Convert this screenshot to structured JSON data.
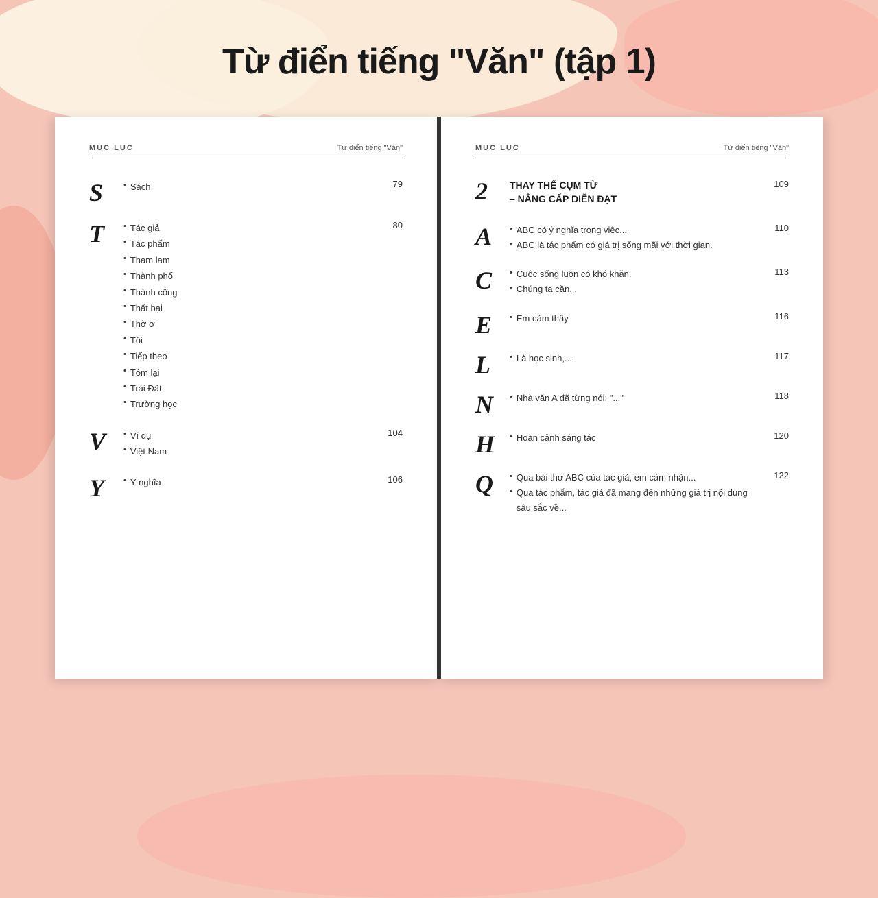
{
  "page": {
    "title": "Từ điển tiếng \"Văn\" (tập 1)",
    "background_color": "#f5c5b8"
  },
  "left_page": {
    "header": {
      "muc_luc": "MỤC LỤC",
      "title": "Từ điển tiếng \"Văn\""
    },
    "sections": [
      {
        "letter": "S",
        "items": [
          "Sách"
        ],
        "page": "79"
      },
      {
        "letter": "T",
        "items": [
          "Tác giả",
          "Tác phẩm",
          "Tham lam",
          "Thành phố",
          "Thành công",
          "Thất bại",
          "Thờ ơ",
          "Tôi",
          "Tiếp theo",
          "Tóm lại",
          "Trái Đất",
          "Trường học"
        ],
        "page": "80"
      },
      {
        "letter": "V",
        "items": [
          "Ví dụ",
          "Việt Nam"
        ],
        "page": "104"
      },
      {
        "letter": "Y",
        "items": [
          "Ý nghĩa"
        ],
        "page": "106"
      }
    ]
  },
  "right_page": {
    "header": {
      "muc_luc": "MỤC LỤC",
      "title": "Từ điển tiếng \"Văn\""
    },
    "chapter": {
      "num": "2",
      "title": "THAY THẾ CỤM TỪ\n– NÂNG CẤP DIỄN ĐẠT",
      "page": "109"
    },
    "sections": [
      {
        "letter": "A",
        "items": [
          "ABC có ý nghĩa trong việc...",
          "ABC là tác phẩm có giá trị sống mãi với thời gian."
        ],
        "page": "110"
      },
      {
        "letter": "C",
        "items": [
          "Cuộc sống luôn có khó khăn.",
          "Chúng ta cần..."
        ],
        "page": "113"
      },
      {
        "letter": "E",
        "items": [
          "Em cảm thấy"
        ],
        "page": "116"
      },
      {
        "letter": "L",
        "items": [
          "Là học sinh,..."
        ],
        "page": "117"
      },
      {
        "letter": "N",
        "items": [
          "Nhà văn A đã từng nói: \"...\""
        ],
        "page": "118"
      },
      {
        "letter": "H",
        "items": [
          "Hoàn cảnh sáng tác"
        ],
        "page": "120"
      },
      {
        "letter": "Q",
        "items": [
          "Qua bài thơ ABC của tác giả, em cảm nhận...",
          "Qua tác phẩm, tác giả đã mang đến những giá trị nội dung sâu sắc về..."
        ],
        "page": "122"
      }
    ]
  }
}
